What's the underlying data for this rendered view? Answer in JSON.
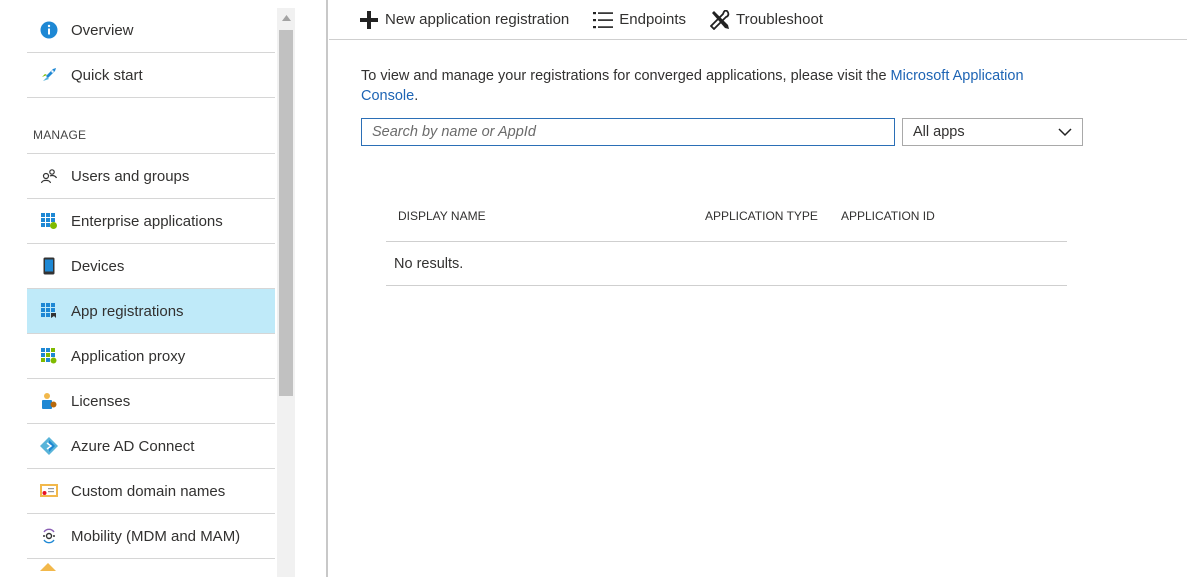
{
  "sidebar": {
    "items_top": [
      {
        "label": "Overview",
        "icon": "info-icon"
      },
      {
        "label": "Quick start",
        "icon": "quick-start-icon"
      }
    ],
    "section_header": "MANAGE",
    "items_manage": [
      {
        "label": "Users and groups",
        "icon": "users-icon"
      },
      {
        "label": "Enterprise applications",
        "icon": "enterprise-apps-icon"
      },
      {
        "label": "Devices",
        "icon": "device-icon"
      },
      {
        "label": "App registrations",
        "icon": "app-registrations-icon",
        "active": true
      },
      {
        "label": "Application proxy",
        "icon": "app-proxy-icon"
      },
      {
        "label": "Licenses",
        "icon": "licenses-icon"
      },
      {
        "label": "Azure AD Connect",
        "icon": "ad-connect-icon"
      },
      {
        "label": "Custom domain names",
        "icon": "domain-icon"
      },
      {
        "label": "Mobility (MDM and MAM)",
        "icon": "mobility-icon"
      }
    ]
  },
  "toolbar": {
    "new_registration": "New application registration",
    "endpoints": "Endpoints",
    "troubleshoot": "Troubleshoot"
  },
  "info": {
    "text": "To view and manage your registrations for converged applications, please visit the ",
    "link": "Microsoft Application Console",
    "suffix": "."
  },
  "search": {
    "placeholder": "Search by name or AppId",
    "value": ""
  },
  "filter": {
    "selected": "All apps"
  },
  "table": {
    "columns": [
      "DISPLAY NAME",
      "APPLICATION TYPE",
      "APPLICATION ID"
    ],
    "empty_message": "No results."
  },
  "colors": {
    "accent": "#2b6fb6",
    "active_bg": "#bfeaf9",
    "link": "#1d64b4"
  }
}
